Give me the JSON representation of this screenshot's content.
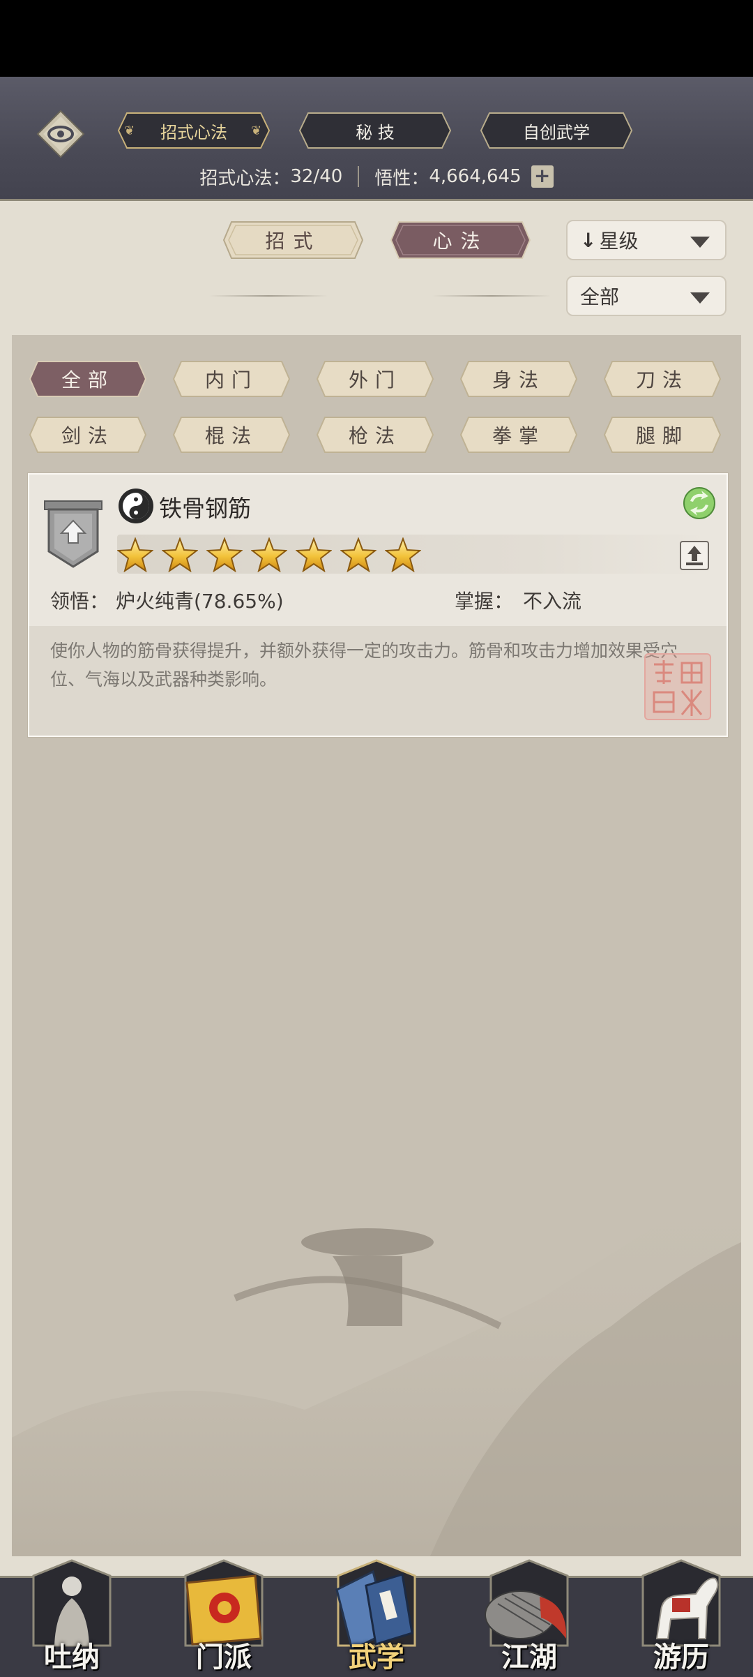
{
  "header": {
    "tabs": [
      {
        "label": "招式心法",
        "active": true
      },
      {
        "label": "秘 技",
        "active": false
      },
      {
        "label": "自创武学",
        "active": false
      }
    ],
    "stats": {
      "moves_label": "招式心法：",
      "moves_value": "32/40",
      "insight_label": "悟性：",
      "insight_value": "4,664,645",
      "plus": "+"
    }
  },
  "subtabs": [
    {
      "label": "招式",
      "active": false
    },
    {
      "label": "心法",
      "active": true
    }
  ],
  "sort_dropdown": {
    "arrow": "↓",
    "value": "星级"
  },
  "filter_dropdown": {
    "value": "全部"
  },
  "categories": [
    {
      "label": "全部",
      "active": true
    },
    {
      "label": "内门"
    },
    {
      "label": "外门"
    },
    {
      "label": "身法"
    },
    {
      "label": "刀法"
    },
    {
      "label": "剑法"
    },
    {
      "label": "棍法"
    },
    {
      "label": "枪法"
    },
    {
      "label": "拳掌"
    },
    {
      "label": "腿脚"
    }
  ],
  "skill": {
    "name": "铁骨钢筋",
    "stars": 7,
    "comprehension_label": "领悟：",
    "comprehension_value": "炉火纯青(78.65%)",
    "mastery_label": "掌握：",
    "mastery_value": "不入流",
    "description": "使你人物的筋骨获得提升，并额外获得一定的攻击力。筋骨和攻击力增加效果受穴位、气海以及武器种类影响。",
    "seal_text": "武林胡说"
  },
  "nav": [
    {
      "label": "吐纳",
      "icon": "meditating-figure-icon"
    },
    {
      "label": "门派",
      "icon": "sect-banner-icon"
    },
    {
      "label": "武学",
      "icon": "martial-book-icon",
      "active": true
    },
    {
      "label": "江湖",
      "icon": "bamboo-hat-icon"
    },
    {
      "label": "游历",
      "icon": "white-horse-icon"
    }
  ],
  "colors": {
    "header_bg": "#4a4a56",
    "active_tab_gold": "#e7d49b",
    "active_chip": "#7d5f64",
    "parchment": "#e3ded2",
    "nav_active": "#f2d27a"
  }
}
